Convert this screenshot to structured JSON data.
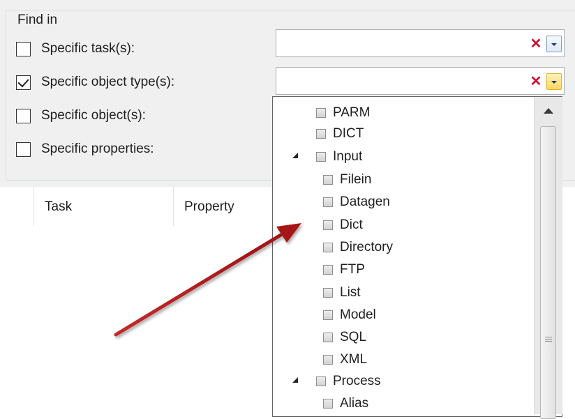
{
  "find_in": {
    "title": "Find in",
    "options": [
      {
        "label": "Specific task(s):",
        "checked": false
      },
      {
        "label": "Specific object type(s):",
        "checked": true
      },
      {
        "label": "Specific object(s):",
        "checked": false
      },
      {
        "label": "Specific properties:",
        "checked": false
      }
    ],
    "clear_glyph": "✕"
  },
  "grid": {
    "columns": [
      "Task",
      "Property"
    ]
  },
  "dropdown": {
    "items": [
      {
        "label": "PARM"
      },
      {
        "label": "DICT"
      },
      {
        "label": "Input"
      },
      {
        "label": "Filein"
      },
      {
        "label": "Datagen"
      },
      {
        "label": "Dict"
      },
      {
        "label": "Directory"
      },
      {
        "label": "FTP"
      },
      {
        "label": "List"
      },
      {
        "label": "Model"
      },
      {
        "label": "SQL"
      },
      {
        "label": "XML"
      },
      {
        "label": "Process"
      },
      {
        "label": "Alias"
      }
    ]
  },
  "colors": {
    "panel_bg": "#f0f0f0",
    "clear_red": "#c8102e",
    "arrow_red": "#b31b1b",
    "dropdown_highlight": "#fcd55b"
  }
}
